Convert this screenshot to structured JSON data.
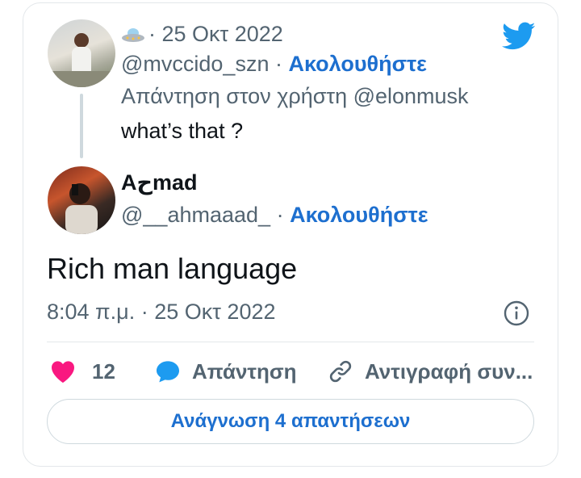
{
  "colors": {
    "accent": "#1d6fcf",
    "like": "#f91880",
    "twitter_blue": "#1d9bf0",
    "muted": "#536471"
  },
  "reply_context": {
    "emoji_icon": "ufo-icon",
    "date": "· 25 Οκτ 2022",
    "handle": "@mvccido_szn",
    "separator": "·",
    "follow_label": "Ακολουθήστε",
    "replying_to": "Απάντηση στον χρήστη @elonmusk",
    "text": "what’s that ?"
  },
  "tweet": {
    "author_name": "Aحmad",
    "handle": "@__ahmaaad_",
    "separator": "·",
    "follow_label": "Ακολουθήστε",
    "text": "Rich man language",
    "timestamp": "8:04 π.μ. · 25 Οκτ 2022",
    "actions": {
      "like_count": "12",
      "reply_label": "Απάντηση",
      "copy_label": "Αντιγραφή συν..."
    },
    "read_replies_label": "Ανάγνωση 4 απαντήσεων"
  }
}
